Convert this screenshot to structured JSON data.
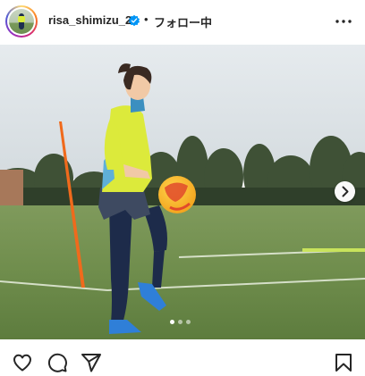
{
  "header": {
    "username": "risa_shimizu_2",
    "separator": "•",
    "follow_label": "フォロー中",
    "verified": true
  },
  "carousel": {
    "slide_count": 3,
    "active_index": 0
  },
  "icons": {
    "like": "heart-icon",
    "comment": "comment-icon",
    "share": "send-icon",
    "save": "bookmark-icon",
    "more": "more-horizontal-icon",
    "next": "chevron-right-icon",
    "verified": "verified-badge-icon"
  },
  "colors": {
    "verified": "#0095f6",
    "text": "#262626"
  }
}
